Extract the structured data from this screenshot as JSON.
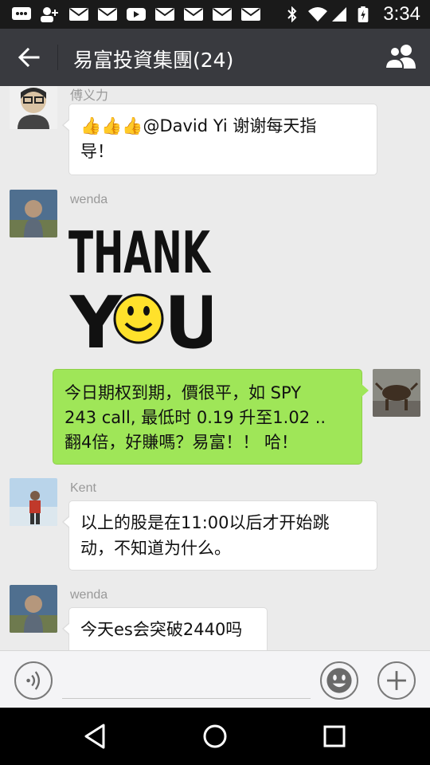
{
  "status_bar": {
    "time": "3:34",
    "icons": [
      "message-icon",
      "add-contact-icon",
      "mail-icon",
      "mail-icon",
      "youtube-icon",
      "mail-icon",
      "mail-icon",
      "mail-icon",
      "mail-icon",
      "bluetooth-icon",
      "wifi-icon",
      "signal-icon",
      "battery-icon"
    ]
  },
  "header": {
    "title": "易富投資集團(24)",
    "back_icon": "arrow-left-icon",
    "members_icon": "group-icon"
  },
  "messages": [
    {
      "sender": "傅义力",
      "side": "left",
      "thumbs": "👍👍👍",
      "text_line1": "@David Yi 谢谢每天指",
      "text_line2": "导！"
    },
    {
      "sender": "wenda",
      "side": "left",
      "type": "sticker",
      "sticker_line1": "THANK",
      "sticker_line2_a": "Y",
      "sticker_line2_b": "U"
    },
    {
      "side": "right",
      "line1": "今日期权到期，價很平，如 SPY",
      "line2": "243 call, 最低时 0.19  升至1.02  ..",
      "line3": "翻4倍，好賺嗎？易富！！  哈！"
    },
    {
      "sender": "Kent",
      "side": "left",
      "line1": "以上的股是在11:00以后才开始跳",
      "line2": "动，不知道为什么。"
    },
    {
      "sender": "wenda",
      "side": "left",
      "line1": "今天es会突破2440吗"
    }
  ],
  "input": {
    "value": "",
    "placeholder": ""
  },
  "colors": {
    "title_bar": "#393a3f",
    "status_bar": "#1a1a1a",
    "chat_bg": "#ebebeb",
    "outgoing_bubble": "#9fe658",
    "incoming_bubble": "#ffffff"
  }
}
